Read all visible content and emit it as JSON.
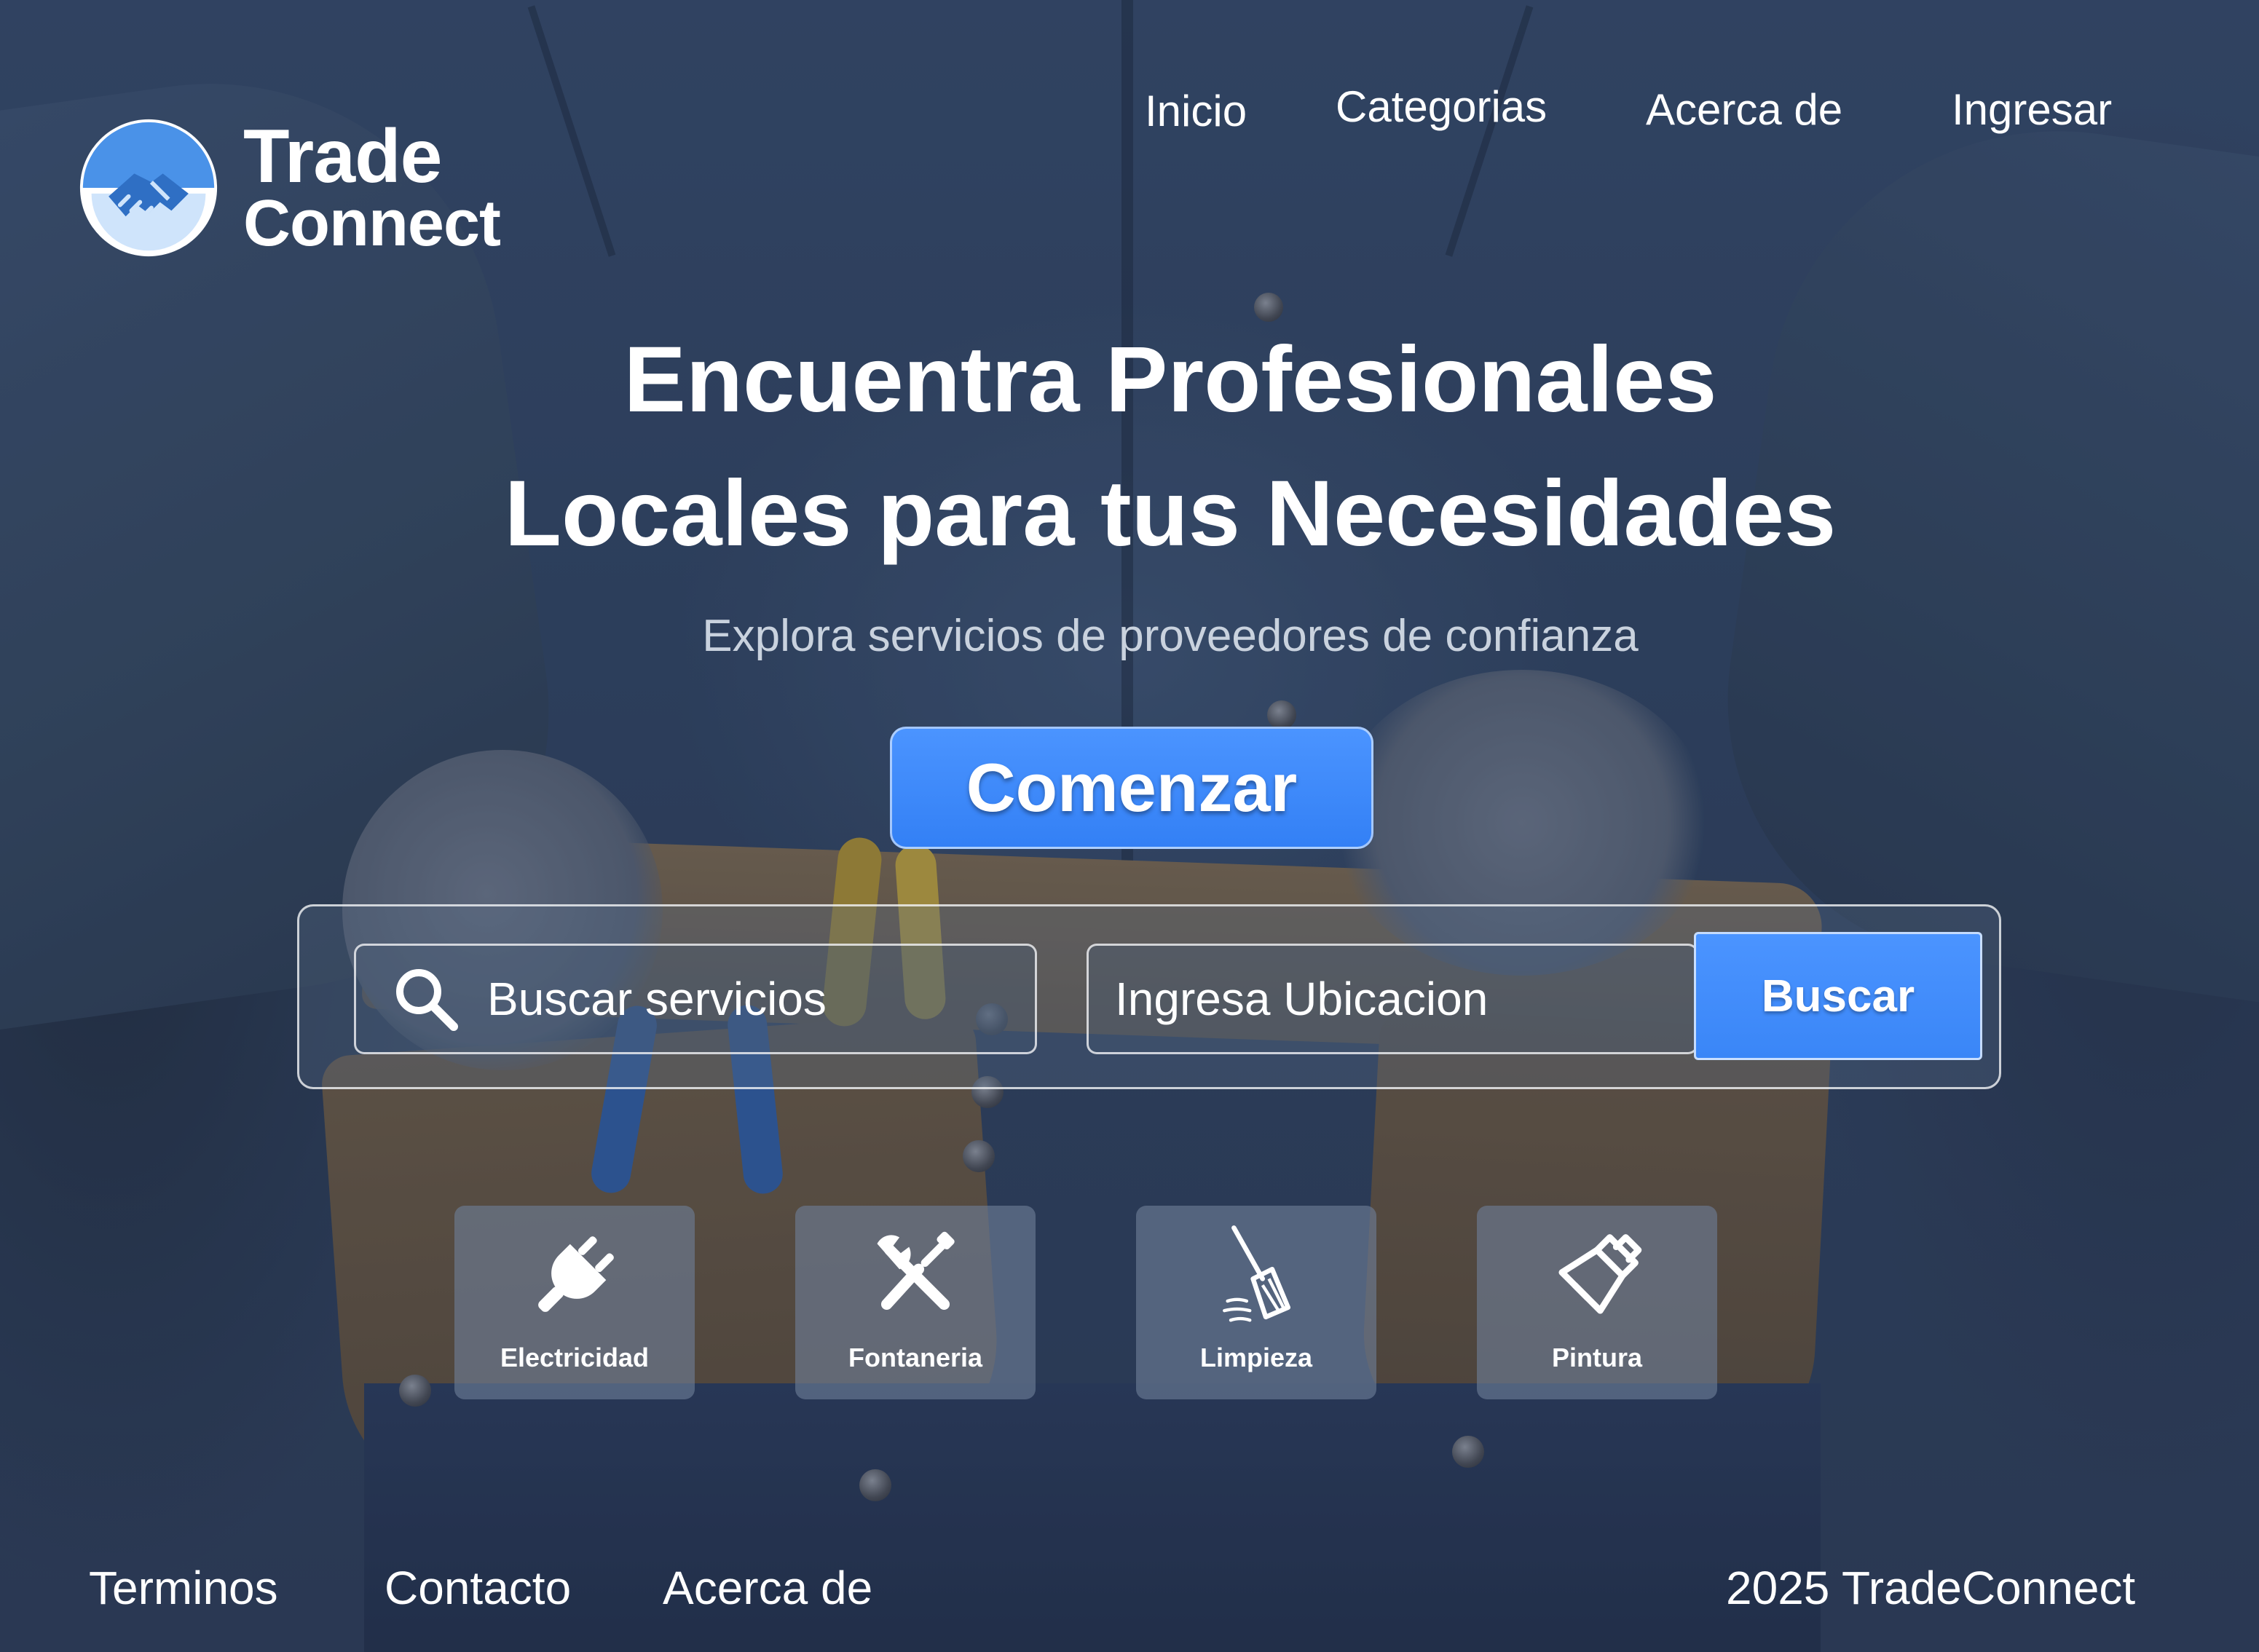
{
  "brand": {
    "name_line1": "Trade",
    "name_line2": "Connect",
    "logo_icon": "handshake-icon",
    "accent_color": "#4b94ff"
  },
  "nav": {
    "items": [
      {
        "label": "Inicio"
      },
      {
        "label": "Categorias"
      },
      {
        "label": "Acerca de"
      },
      {
        "label": "Ingresar"
      }
    ]
  },
  "hero": {
    "title_line1": "Encuentra Profesionales",
    "title_line2": "Locales para tus Necesidades",
    "subtitle": "Explora servicios de proveedores de confianza",
    "cta_label": "Comenzar"
  },
  "search": {
    "service_placeholder": "Buscar servicios",
    "location_placeholder": "Ingresa Ubicacion",
    "button_label": "Buscar",
    "service_icon": "search-icon"
  },
  "categories": [
    {
      "label": "Electricidad",
      "icon": "plug-icon"
    },
    {
      "label": "Fontaneria",
      "icon": "wrench-screwdriver-icon"
    },
    {
      "label": "Limpieza",
      "icon": "broom-icon"
    },
    {
      "label": "Pintura",
      "icon": "paintbrush-icon"
    }
  ],
  "footer": {
    "links": [
      {
        "label": "Terminos"
      },
      {
        "label": "Contacto"
      },
      {
        "label": "Acerca de"
      }
    ],
    "copyright": "2025 TradeConnect"
  }
}
